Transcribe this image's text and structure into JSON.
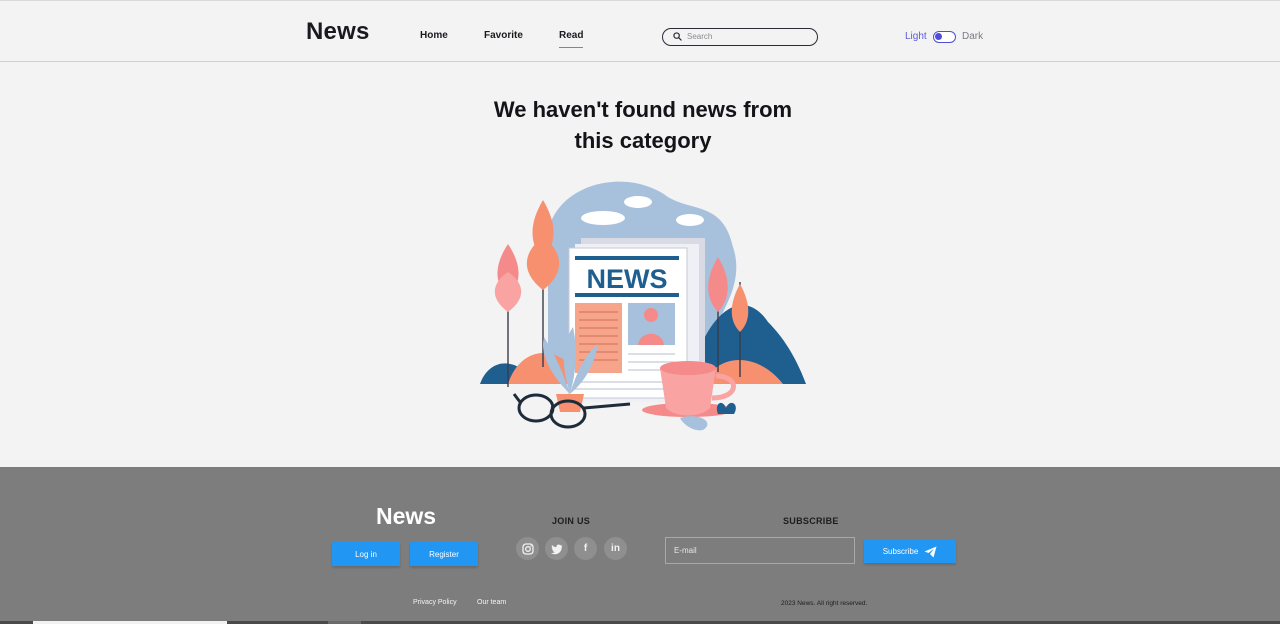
{
  "header": {
    "logo": "News",
    "nav": [
      {
        "label": "Home"
      },
      {
        "label": "Favorite"
      },
      {
        "label": "Read"
      }
    ],
    "search_placeholder": "Search",
    "theme_light": "Light",
    "theme_dark": "Dark"
  },
  "main": {
    "title_line1": "We haven't found news from",
    "title_line2": "this category",
    "illustration_headline": "NEWS"
  },
  "footer": {
    "logo": "News",
    "login_label": "Log in",
    "register_label": "Register",
    "join_heading": "JOIN US",
    "subscribe_heading": "SUBSCRIBE",
    "email_placeholder": "E-mail",
    "subscribe_label": "Subscribe",
    "privacy_link": "Privacy Policy",
    "team_link": "Our team",
    "copyright": "2023 News. All right reserved."
  },
  "colors": {
    "accent": "#2196f3",
    "toggle": "#4f4fd6",
    "footer_bg": "#7d7d7d",
    "page_bg": "#f3f3f4"
  }
}
